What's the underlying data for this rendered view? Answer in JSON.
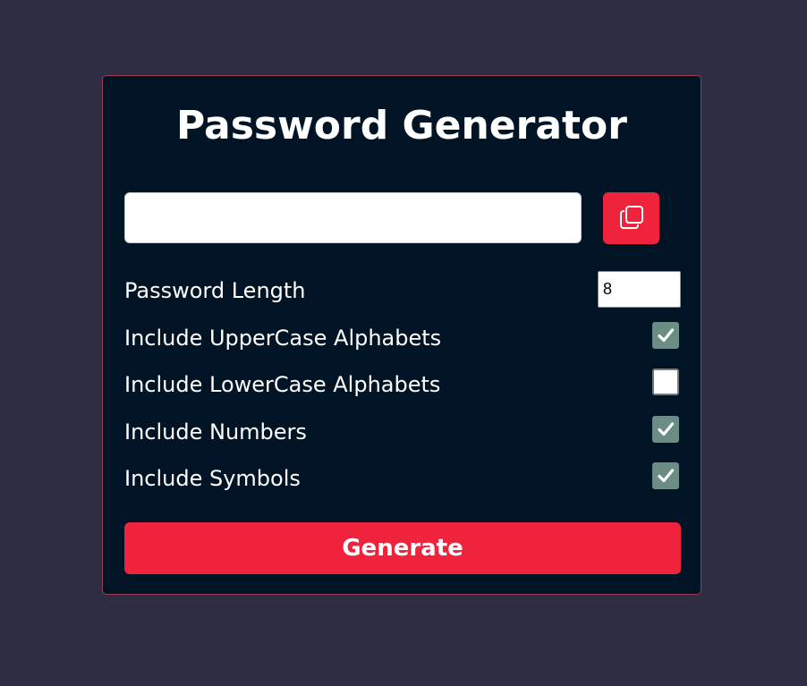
{
  "app": {
    "title": "Password Generator"
  },
  "password_field": {
    "value": "",
    "placeholder": ""
  },
  "copy_button": {
    "icon": "copy-icon"
  },
  "options": {
    "length": {
      "label": "Password Length",
      "value": "8"
    },
    "uppercase": {
      "label": "Include UpperCase Alphabets",
      "checked": true
    },
    "lowercase": {
      "label": "Include LowerCase Alphabets",
      "checked": false
    },
    "numbers": {
      "label": "Include Numbers",
      "checked": true
    },
    "symbols": {
      "label": "Include Symbols",
      "checked": true
    }
  },
  "generate_button": {
    "label": "Generate"
  },
  "colors": {
    "page_background": "#2d2d44",
    "card_background": "#011425",
    "accent": "#ef233c",
    "checkbox_checked": "#6c8d84"
  }
}
